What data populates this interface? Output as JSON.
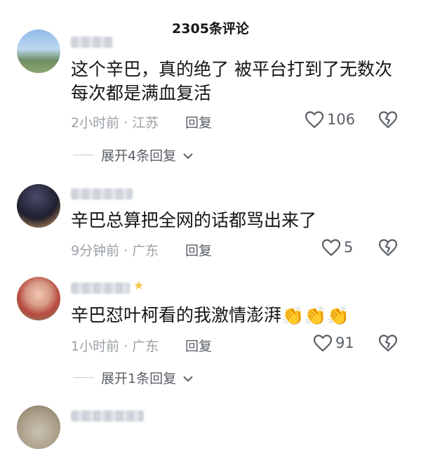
{
  "header": {
    "title": "2305条评论"
  },
  "comments": [
    {
      "username": "····",
      "text_line1": "这个辛巴，真的绝了 被平台打到了无数次",
      "text_line2": "每次都是满血复活",
      "time": "2小时前 · 江苏",
      "reply_label": "回复",
      "likes": "106",
      "expand_label": "展开4条回复"
    },
    {
      "username": "····",
      "text_line1": "辛巴总算把全网的话都骂出来了",
      "time": "9分钟前 · 广东",
      "reply_label": "回复",
      "likes": "5"
    },
    {
      "username": "····",
      "text_line1": "辛巴怼叶柯看的我激情澎湃",
      "emojis": "👏👏👏",
      "time": "1小时前 · 广东",
      "reply_label": "回复",
      "likes": "91",
      "expand_label": "展开1条回复"
    },
    {
      "username": "····"
    }
  ],
  "icons": {
    "like": "heart-icon",
    "dislike": "broken-heart-icon",
    "expand": "chevron-down-icon",
    "badge": "star-icon"
  }
}
